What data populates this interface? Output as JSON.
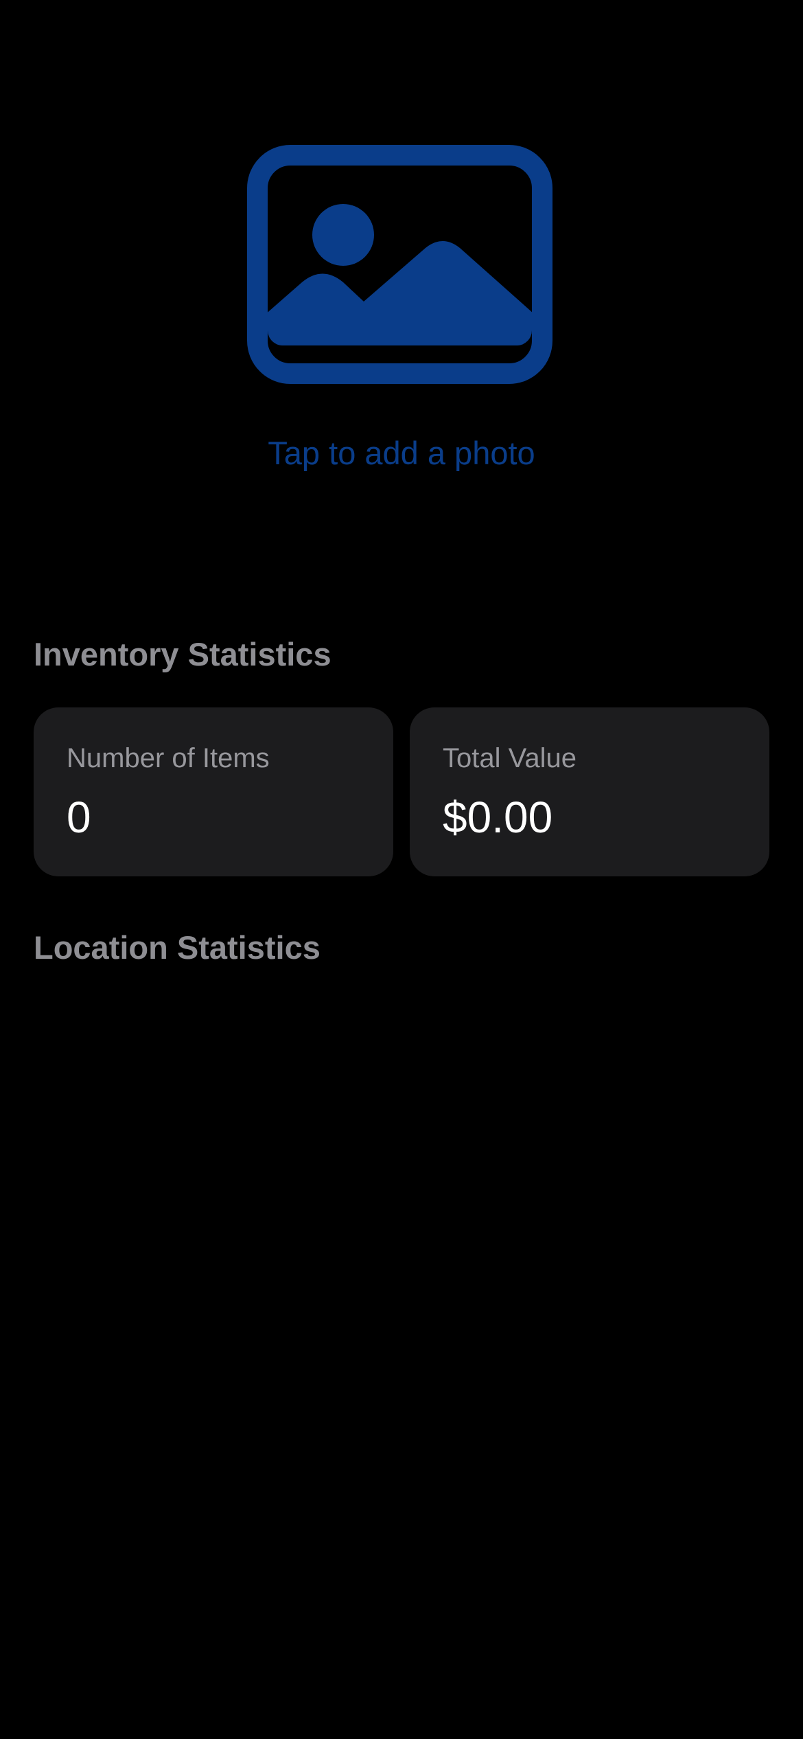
{
  "photo": {
    "icon": "photo-placeholder-icon",
    "caption": "Tap to add a photo"
  },
  "colors": {
    "accent": "#0a3d8a",
    "background": "#000000",
    "card": "#1c1c1e",
    "section_header": "#8e8e93"
  },
  "inventory_statistics": {
    "title": "Inventory Statistics",
    "cards": [
      {
        "label": "Number of Items",
        "value": "0"
      },
      {
        "label": "Total Value",
        "value": "$0.00"
      }
    ]
  },
  "location_statistics": {
    "title": "Location Statistics"
  }
}
